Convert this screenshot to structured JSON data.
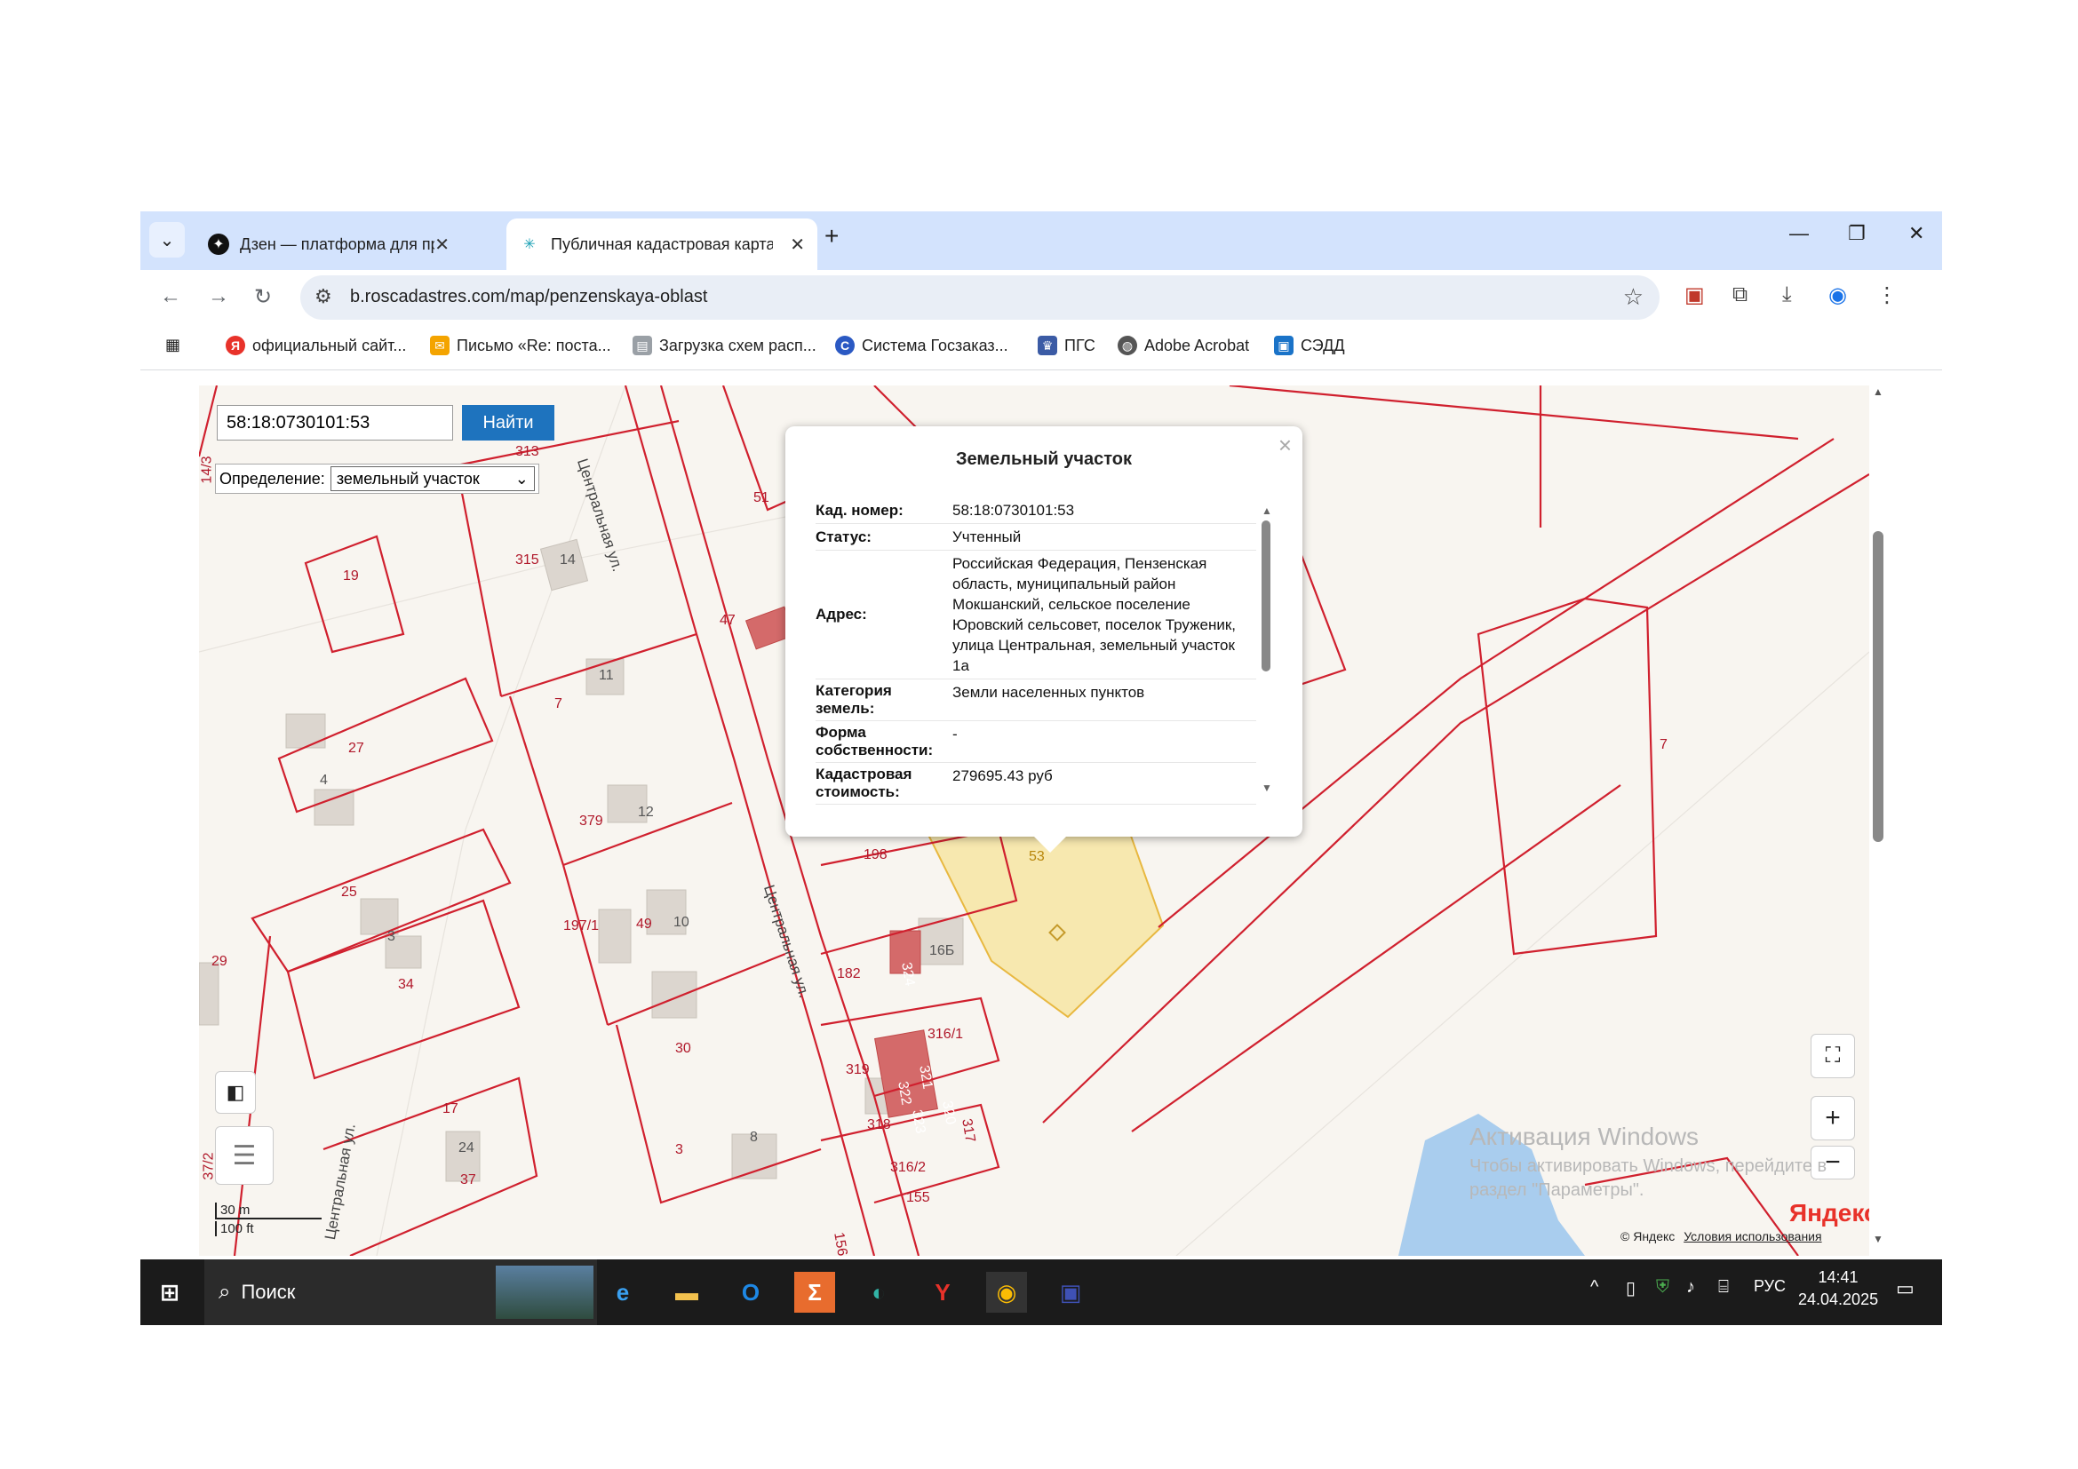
{
  "browser": {
    "tabs": [
      {
        "title": "Дзен — платформа для просм",
        "icon": "dzen-icon",
        "active": false
      },
      {
        "title": "Публичная кадастровая карта",
        "icon": "roscadastres-icon",
        "active": true
      }
    ],
    "url": "b.roscadastres.com/map/penzenskaya-oblast",
    "bookmarks": [
      {
        "label": "официальный сайт...",
        "icon": "yandex-icon",
        "color": "#e8322a"
      },
      {
        "label": "Письмо «Re: поста...",
        "icon": "mail-icon",
        "color": "#f4a400"
      },
      {
        "label": "Загрузка схем расп...",
        "icon": "document-icon",
        "color": "#9aa0a6"
      },
      {
        "label": "Система Госзаказ...",
        "icon": "goszakaz-icon",
        "color": "#2b59c3"
      },
      {
        "label": "ПГС",
        "icon": "emblem-icon",
        "color": "#3b5ba5"
      },
      {
        "label": "Adobe Acrobat",
        "icon": "globe-icon",
        "color": "#555555"
      },
      {
        "label": "СЭДД",
        "icon": "sedd-icon",
        "color": "#1a73c8"
      }
    ]
  },
  "map": {
    "search": {
      "value": "58:18:0730101:53",
      "button": "Найти"
    },
    "definition": {
      "label": "Определение:",
      "selected": "земельный участок"
    },
    "street_labels": [
      "Центральная ул.",
      "Центральная ул.",
      "Центральная ул."
    ],
    "parcel_labels": [
      "51",
      "315",
      "14",
      "47",
      "19",
      "7",
      "11",
      "27",
      "4",
      "379",
      "12",
      "25",
      "3",
      "197/1",
      "49",
      "10",
      "29",
      "34",
      "30",
      "17",
      "24",
      "37",
      "3",
      "8",
      "156",
      "155",
      "198",
      "182",
      "16Б",
      "324",
      "53",
      "319",
      "316/1",
      "321",
      "322",
      "323",
      "320",
      "317",
      "318",
      "316/2",
      "7",
      "14/3",
      "37/2",
      "313"
    ],
    "popup": {
      "title": "Земельный участок",
      "rows": [
        {
          "key": "Кад. номер:",
          "value": "58:18:0730101:53"
        },
        {
          "key": "Статус:",
          "value": "Учтенный"
        },
        {
          "key": "Адрес:",
          "value": "Российская Федерация, Пензенская область, муниципальный район Мокшанский, сельское поселение Юровский сельсовет, поселок Труженик, улица Центральная, земельный участок 1а"
        },
        {
          "key": "Категория земель:",
          "value": "Земли населенных пунктов"
        },
        {
          "key": "Форма собственности:",
          "value": "-"
        },
        {
          "key": "Кадастровая стоимость:",
          "value": "279695.43 руб"
        }
      ]
    },
    "scale": {
      "metric": "30 m",
      "imperial": "100 ft"
    },
    "watermark": {
      "line1": "Активация Windows",
      "line2": "Чтобы активировать Windows, перейдите в",
      "line3": "раздел \"Параметры\"."
    },
    "yandex_logo": "Яндекс",
    "copyright": "© Яндекс",
    "terms": "Условия использования",
    "zoom_in": "+",
    "zoom_out": "−"
  },
  "taskbar": {
    "search_placeholder": "Поиск",
    "apps": [
      "edge-legacy-icon",
      "file-explorer-icon",
      "outlook-icon",
      "sigma-app-icon",
      "edge-icon",
      "yandex-browser-icon",
      "chrome-icon",
      "floppy-app-icon"
    ],
    "language": "РУС",
    "time": "14:41",
    "date": "24.04.2025"
  },
  "colors": {
    "tabstrip": "#d3e3fd",
    "parcel_line": "#d0202e",
    "selected_parcel": "#f5d36b",
    "building": "#d9d3cb",
    "find_button": "#1e73be"
  }
}
